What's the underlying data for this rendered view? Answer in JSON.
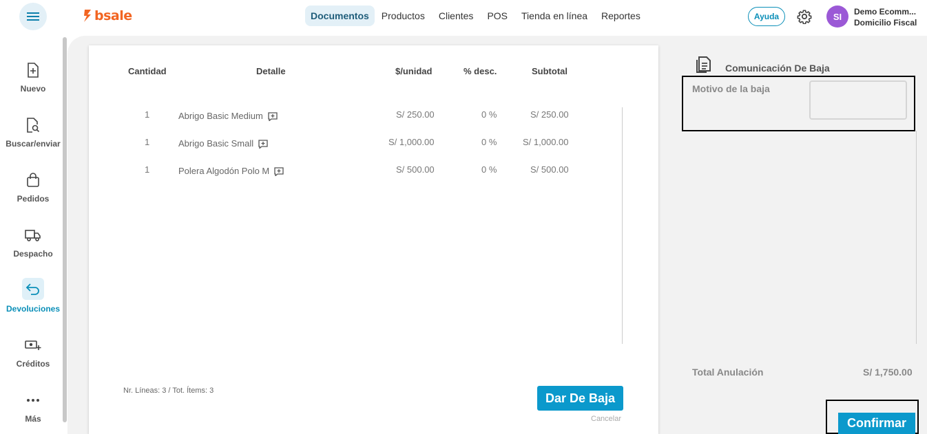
{
  "brand": {
    "name": "bsale"
  },
  "nav": {
    "items": [
      {
        "label": "Documentos",
        "active": true
      },
      {
        "label": "Productos"
      },
      {
        "label": "Clientes"
      },
      {
        "label": "POS"
      },
      {
        "label": "Tienda en línea"
      },
      {
        "label": "Reportes"
      }
    ]
  },
  "header": {
    "help_label": "Ayuda",
    "avatar_initials": "SI",
    "user_name": "Demo Ecomm...",
    "user_subtitle": "Domicilio Fiscal"
  },
  "sidebar": {
    "items": [
      {
        "label": "Nuevo",
        "icon": "new-document-icon"
      },
      {
        "label": "Buscar/enviar",
        "icon": "search-document-icon"
      },
      {
        "label": "Pedidos",
        "icon": "shopping-bag-icon"
      },
      {
        "label": "Despacho",
        "icon": "truck-icon"
      },
      {
        "label": "Devoluciones",
        "icon": "return-arrow-icon",
        "active": true
      },
      {
        "label": "Créditos",
        "icon": "money-plus-icon"
      },
      {
        "label": "Más",
        "icon": "more-dots-icon"
      }
    ]
  },
  "table": {
    "headers": {
      "qty": "Cantidad",
      "detail": "Detalle",
      "unit": "$/unidad",
      "disc": "% desc.",
      "subtotal": "Subtotal"
    },
    "rows": [
      {
        "qty": "1",
        "detail": "Abrigo Basic Medium",
        "unit": "S/ 250.00",
        "disc": "0 %",
        "subtotal": "S/ 250.00"
      },
      {
        "qty": "1",
        "detail": "Abrigo Basic Small",
        "unit": "S/ 1,000.00",
        "disc": "0 %",
        "subtotal": "S/ 1,000.00"
      },
      {
        "qty": "1",
        "detail": "Polera Algodón Polo M",
        "unit": "S/ 500.00",
        "disc": "0 %",
        "subtotal": "S/ 500.00"
      }
    ]
  },
  "footer": {
    "info": "Nr. Líneas: 3 / Tot. Ítems: 3",
    "baja_button": "Dar De Baja",
    "cancel_link": "Cancelar"
  },
  "panel": {
    "title": "Comunicación De Baja",
    "motivo_label": "Motivo de la baja",
    "motivo_value": "",
    "total_label": "Total Anulación",
    "total_value": "S/ 1,750.00",
    "confirm_button": "Confirmar"
  },
  "colors": {
    "accent": "#0b99cc",
    "brand": "#f26522",
    "avatar": "#9b59d6"
  }
}
